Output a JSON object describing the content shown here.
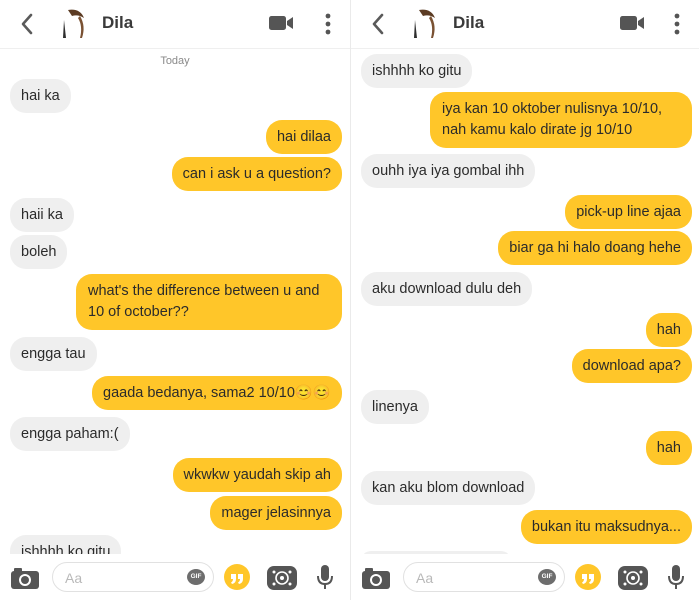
{
  "contact_name": "Dila",
  "colors": {
    "outgoing": "#ffc629",
    "incoming": "#efefef",
    "icons": "#555555"
  },
  "icons": {
    "back": "chevron-left-icon",
    "video": "video-camera-icon",
    "more": "more-vertical-icon",
    "camera": "camera-icon",
    "gif": "gif-icon",
    "quote": "quote-icon",
    "sticker": "sticker-icon",
    "mic": "microphone-icon"
  },
  "left": {
    "day_label": "Today",
    "messages": [
      {
        "dir": "in",
        "text": "hai ka"
      },
      {
        "dir": "out",
        "text": "hai dilaa"
      },
      {
        "dir": "out",
        "text": "can i ask u a question?"
      },
      {
        "dir": "in",
        "text": "haii ka"
      },
      {
        "dir": "in",
        "text": "boleh"
      },
      {
        "dir": "out",
        "text": "what's the difference between u and 10 of october??"
      },
      {
        "dir": "in",
        "text": "engga tau"
      },
      {
        "dir": "out",
        "text": "gaada bedanya, sama2 10/10😊😊"
      },
      {
        "dir": "in",
        "text": "engga paham:("
      },
      {
        "dir": "out",
        "text": "wkwkw yaudah skip ah"
      },
      {
        "dir": "out",
        "text": "mager jelasinnya"
      },
      {
        "dir": "in",
        "text": "ishhhh ko gitu"
      }
    ]
  },
  "right": {
    "messages": [
      {
        "dir": "in",
        "text": "ishhhh ko gitu"
      },
      {
        "dir": "out",
        "text": "iya kan 10 oktober nulisnya 10/10, nah kamu kalo dirate jg 10/10"
      },
      {
        "dir": "in",
        "text": "ouhh iya iya gombal ihh"
      },
      {
        "dir": "out",
        "text": "pick-up line ajaa"
      },
      {
        "dir": "out",
        "text": "biar ga hi halo doang hehe"
      },
      {
        "dir": "in",
        "text": "aku download dulu deh"
      },
      {
        "dir": "out",
        "text": "hah"
      },
      {
        "dir": "out",
        "text": "download apa?"
      },
      {
        "dir": "in",
        "text": "linenya"
      },
      {
        "dir": "out",
        "text": "hah"
      },
      {
        "dir": "in",
        "text": "kan aku blom download"
      },
      {
        "dir": "out",
        "text": "bukan itu maksudnya..."
      }
    ]
  },
  "composer": {
    "placeholder": "Aa",
    "gif_label": "GIF"
  }
}
